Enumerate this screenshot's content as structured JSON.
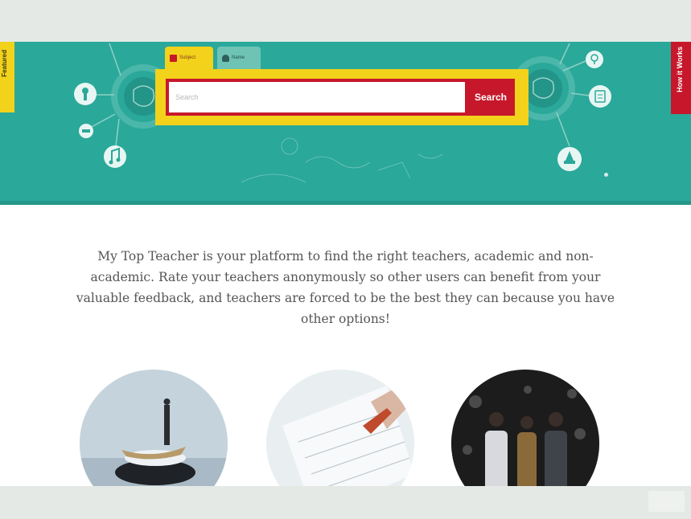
{
  "side_tabs": {
    "left_label": "Featured",
    "right_label": "How it Works"
  },
  "search": {
    "tabs": [
      {
        "label": "Subject"
      },
      {
        "label": "Name"
      }
    ],
    "placeholder": "Search",
    "button_label": "Search"
  },
  "intro": {
    "text": "My Top Teacher is your platform to find the right teachers, academic and non-academic. Rate your teachers anonymously so other users can benefit from your valuable feedback, and teachers are forced to be the best they can because you have other options!"
  },
  "colors": {
    "hero_teal": "#2aa89a",
    "accent_yellow": "#f2d21b",
    "accent_red": "#c7182b"
  }
}
